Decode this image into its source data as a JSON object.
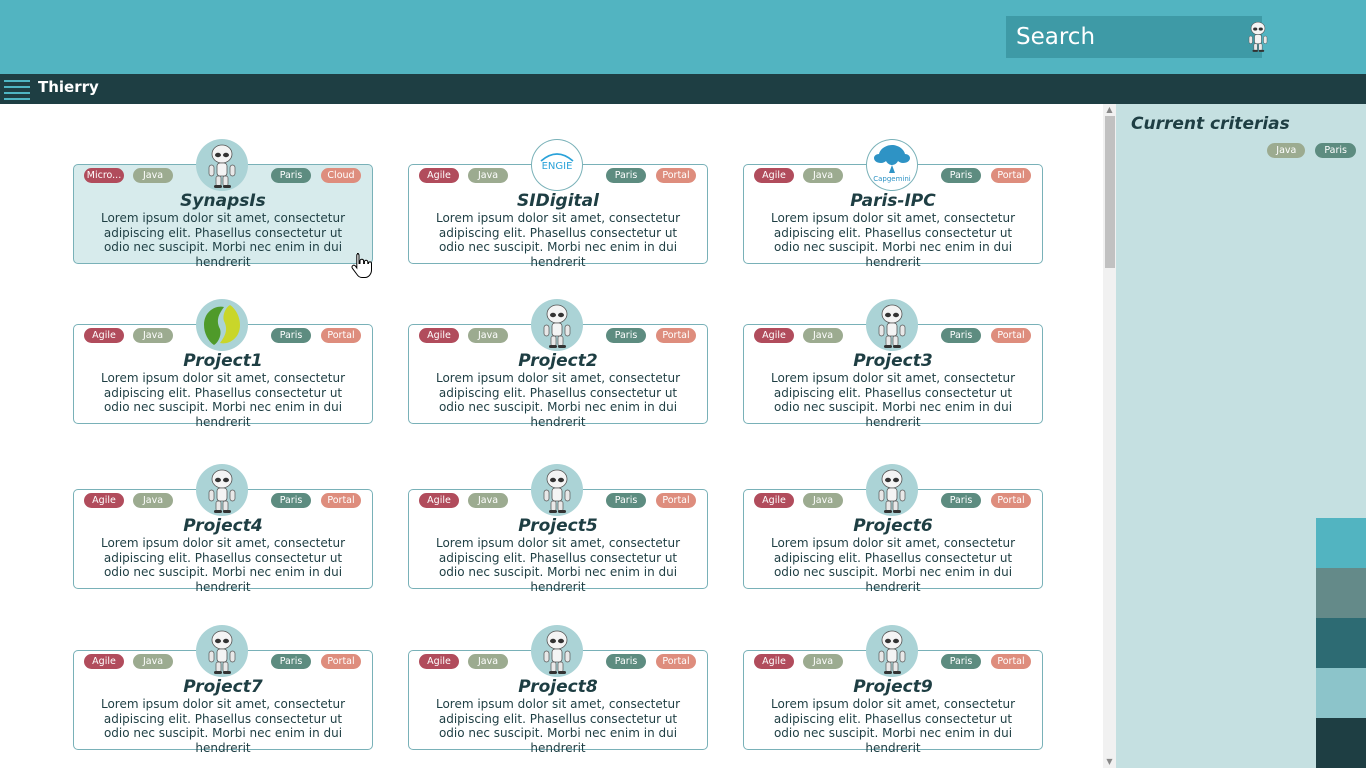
{
  "search": {
    "placeholder": "Search"
  },
  "user": {
    "name": "Thierry"
  },
  "sidebar": {
    "title": "Current criterias",
    "criteria": [
      {
        "label": "Java",
        "color": "#9cab90"
      },
      {
        "label": "Paris",
        "color": "#5d8c80"
      }
    ]
  },
  "palette": [
    "#52b4c1",
    "#648a89",
    "#2d6b73",
    "#8cc4ca",
    "#1e3e43"
  ],
  "colors": {
    "topbar": "#52b4c1",
    "navbar": "#1e3e43",
    "sidebar": "#c5e0e1"
  },
  "projects": [
    {
      "name": "SynapsIs",
      "logo": "robot-icon",
      "tags": [
        "Micro...",
        "Java",
        "Paris",
        "Cloud"
      ],
      "description": "Lorem ipsum dolor sit amet, consectetur adipiscing elit. Phasellus consectetur ut odio nec suscipit. Morbi nec enim in dui hendrerit"
    },
    {
      "name": "SIDigital",
      "logo": "engie-logo",
      "tags": [
        "Agile",
        "Java",
        "Paris",
        "Portal"
      ],
      "description": "Lorem ipsum dolor sit amet, consectetur adipiscing elit. Phasellus consectetur ut odio nec suscipit. Morbi nec enim in dui hendrerit"
    },
    {
      "name": "Paris-IPC",
      "logo": "capgemini-logo",
      "tags": [
        "Agile",
        "Java",
        "Paris",
        "Portal"
      ],
      "description": "Lorem ipsum dolor sit amet, consectetur adipiscing elit. Phasellus consectetur ut odio nec suscipit. Morbi nec enim in dui hendrerit"
    },
    {
      "name": "Project1",
      "logo": "leaf-logo",
      "tags": [
        "Agile",
        "Java",
        "Paris",
        "Portal"
      ],
      "description": "Lorem ipsum dolor sit amet, consectetur adipiscing elit. Phasellus consectetur ut odio nec suscipit. Morbi nec enim in dui hendrerit"
    },
    {
      "name": "Project2",
      "logo": "robot-icon",
      "tags": [
        "Agile",
        "Java",
        "Paris",
        "Portal"
      ],
      "description": "Lorem ipsum dolor sit amet, consectetur adipiscing elit. Phasellus consectetur ut odio nec suscipit. Morbi nec enim in dui hendrerit"
    },
    {
      "name": "Project3",
      "logo": "robot-icon",
      "tags": [
        "Agile",
        "Java",
        "Paris",
        "Portal"
      ],
      "description": "Lorem ipsum dolor sit amet, consectetur adipiscing elit. Phasellus consectetur ut odio nec suscipit. Morbi nec enim in dui hendrerit"
    },
    {
      "name": "Project4",
      "logo": "robot-icon",
      "tags": [
        "Agile",
        "Java",
        "Paris",
        "Portal"
      ],
      "description": "Lorem ipsum dolor sit amet, consectetur adipiscing elit. Phasellus consectetur ut odio nec suscipit. Morbi nec enim in dui hendrerit"
    },
    {
      "name": "Project5",
      "logo": "robot-icon",
      "tags": [
        "Agile",
        "Java",
        "Paris",
        "Portal"
      ],
      "description": "Lorem ipsum dolor sit amet, consectetur adipiscing elit. Phasellus consectetur ut odio nec suscipit. Morbi nec enim in dui hendrerit"
    },
    {
      "name": "Project6",
      "logo": "robot-icon",
      "tags": [
        "Agile",
        "Java",
        "Paris",
        "Portal"
      ],
      "description": "Lorem ipsum dolor sit amet, consectetur adipiscing elit. Phasellus consectetur ut odio nec suscipit. Morbi nec enim in dui hendrerit"
    },
    {
      "name": "Project7",
      "logo": "robot-icon",
      "tags": [
        "Agile",
        "Java",
        "Paris",
        "Portal"
      ],
      "description": "Lorem ipsum dolor sit amet, consectetur adipiscing elit. Phasellus consectetur ut odio nec suscipit. Morbi nec enim in dui hendrerit"
    },
    {
      "name": "Project8",
      "logo": "robot-icon",
      "tags": [
        "Agile",
        "Java",
        "Paris",
        "Portal"
      ],
      "description": "Lorem ipsum dolor sit amet, consectetur adipiscing elit. Phasellus consectetur ut odio nec suscipit. Morbi nec enim in dui hendrerit"
    },
    {
      "name": "Project9",
      "logo": "robot-icon",
      "tags": [
        "Agile",
        "Java",
        "Paris",
        "Portal"
      ],
      "description": "Lorem ipsum dolor sit amet, consectetur adipiscing elit. Phasellus consectetur ut odio nec suscipit. Morbi nec enim in dui hendrerit"
    }
  ]
}
